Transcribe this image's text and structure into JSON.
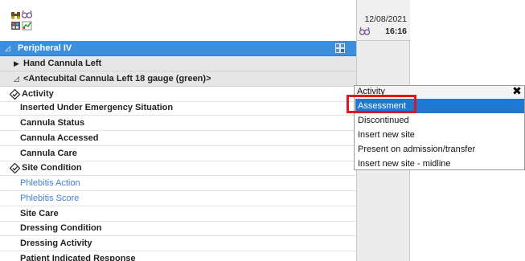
{
  "header": {
    "date": "12/08/2021",
    "time": "16:16"
  },
  "rows": [
    {
      "kind": "section",
      "label": "Peripheral IV"
    },
    {
      "kind": "group",
      "label": "Hand Cannula Left"
    },
    {
      "kind": "group",
      "label": "<Antecubital Cannula Left 18 gauge (green)>"
    },
    {
      "kind": "item",
      "label": "Activity"
    },
    {
      "kind": "item",
      "label": "Inserted Under Emergency Situation"
    },
    {
      "kind": "item",
      "label": "Cannula Status"
    },
    {
      "kind": "item",
      "label": "Cannula Accessed"
    },
    {
      "kind": "item",
      "label": "Cannula Care"
    },
    {
      "kind": "item",
      "label": "Site Condition"
    },
    {
      "kind": "link",
      "label": "Phlebitis Action"
    },
    {
      "kind": "link",
      "label": "Phlebitis Score"
    },
    {
      "kind": "item",
      "label": "Site Care"
    },
    {
      "kind": "item",
      "label": "Dressing Condition"
    },
    {
      "kind": "item",
      "label": "Dressing Activity"
    },
    {
      "kind": "item",
      "label": "Patient Indicated Response"
    }
  ],
  "dropdown": {
    "title": "Activity",
    "close_glyph": "✖",
    "options": [
      "Assessment",
      "Discontinued",
      "Insert new site",
      "Present on admission/transfer",
      "Insert new site - midline"
    ],
    "selected": "Assessment"
  },
  "colors": {
    "section_bg": "#3b8fdc",
    "selected_bg": "#1f78d1",
    "highlight_border": "#e0151d",
    "link_text": "#3f7fd0"
  },
  "icons": {
    "toolbar": [
      "binoculars-icon",
      "glasses-icon",
      "calculator-icon",
      "chart-icon"
    ],
    "section_toggle": "collapse-triangle-icon",
    "section_action": "grid-icon",
    "expand": "expand-triangle-icon",
    "collapse": "collapse-triangle-icon",
    "activity": "diamond-check-icon",
    "time": "glasses-icon"
  }
}
